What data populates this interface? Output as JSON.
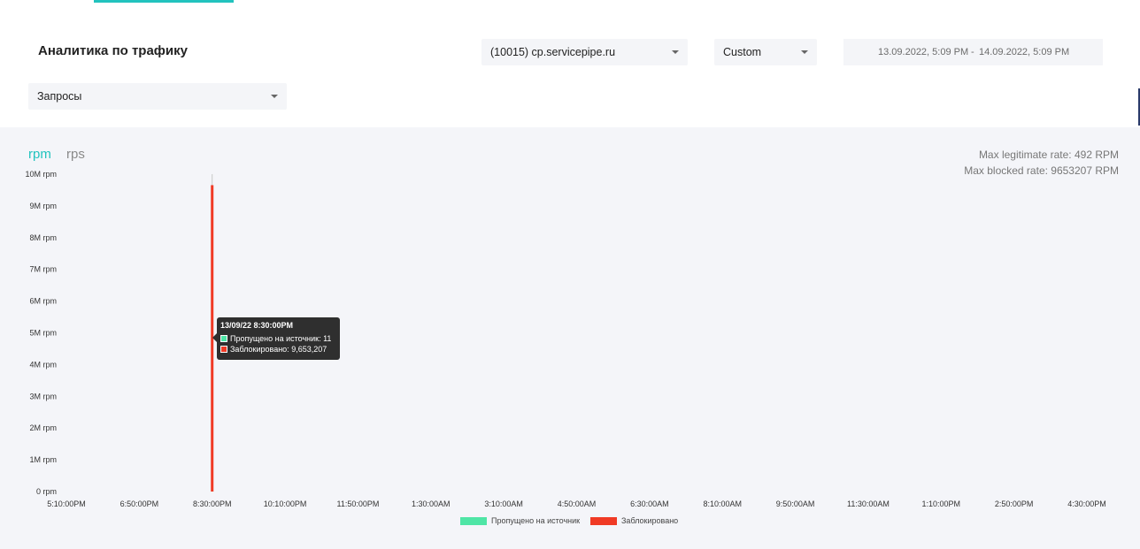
{
  "header": {
    "title": "Аналитика по трафику",
    "site_select": "(10015) cp.servicepipe.ru",
    "period_select": "Custom",
    "date_from": "13.09.2022, 5:09 PM",
    "date_sep": "-",
    "date_to": "14.09.2022, 5:09 PM",
    "metric_select": "Запросы"
  },
  "units": {
    "active": "rpm",
    "inactive": "rps"
  },
  "stats": {
    "max_legit": "Max legitimate rate: 492 RPM",
    "max_blocked": "Max blocked rate: 9653207 RPM"
  },
  "tooltip": {
    "title": "13/09/22 8:30:00PM",
    "row1": "Пропущено на источник: 11",
    "row2": "Заблокировано: 9,653,207"
  },
  "colors": {
    "accent": "#22c3be",
    "passed": "#4fe5a6",
    "blocked": "#f03a25"
  },
  "chart_data": {
    "type": "bar",
    "x": [
      "5:10:00PM",
      "6:50:00PM",
      "8:30:00PM",
      "10:10:00PM",
      "11:50:00PM",
      "1:30:00AM",
      "3:10:00AM",
      "4:50:00AM",
      "6:30:00AM",
      "8:10:00AM",
      "9:50:00AM",
      "11:30:00AM",
      "1:10:00PM",
      "2:50:00PM",
      "4:30:00PM"
    ],
    "y_ticks": [
      "0 rpm",
      "1M rpm",
      "2M rpm",
      "3M rpm",
      "4M rpm",
      "5M rpm",
      "6M rpm",
      "7M rpm",
      "8M rpm",
      "9M rpm",
      "10M rpm"
    ],
    "ylim": [
      0,
      10000000
    ],
    "series": [
      {
        "name": "Пропущено на источник",
        "color": "#4fe5a6",
        "points": [
          {
            "x": "8:30:00PM",
            "y": 11
          }
        ]
      },
      {
        "name": "Заблокировано",
        "color": "#f03a25",
        "points": [
          {
            "x": "8:30:00PM",
            "y": 9653207
          }
        ]
      }
    ]
  }
}
